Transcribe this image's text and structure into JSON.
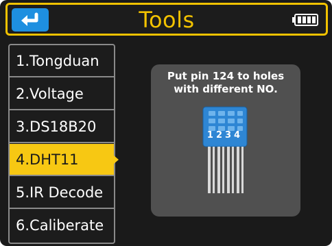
{
  "header": {
    "title": "Tools",
    "back_icon": "return-arrow-icon",
    "battery_icon": "battery-full-icon"
  },
  "menu": {
    "items": [
      {
        "label": "1.Tongduan",
        "selected": false
      },
      {
        "label": "2.Voltage",
        "selected": false
      },
      {
        "label": "3.DS18B20",
        "selected": false
      },
      {
        "label": "4.DHT11",
        "selected": true
      },
      {
        "label": "5.IR Decode",
        "selected": false
      },
      {
        "label": "6.Caliberate",
        "selected": false
      }
    ]
  },
  "panel": {
    "instruction_line1": "Put pin 124 to holes",
    "instruction_line2": "with different NO.",
    "pin_labels": "1234",
    "sensor_icon": "dht11-sensor-icon"
  },
  "colors": {
    "accent": "#f2c200",
    "back_button": "#1e8fe0",
    "background": "#1a1a1a",
    "panel": "#505050",
    "sensor": "#2e86d4"
  }
}
